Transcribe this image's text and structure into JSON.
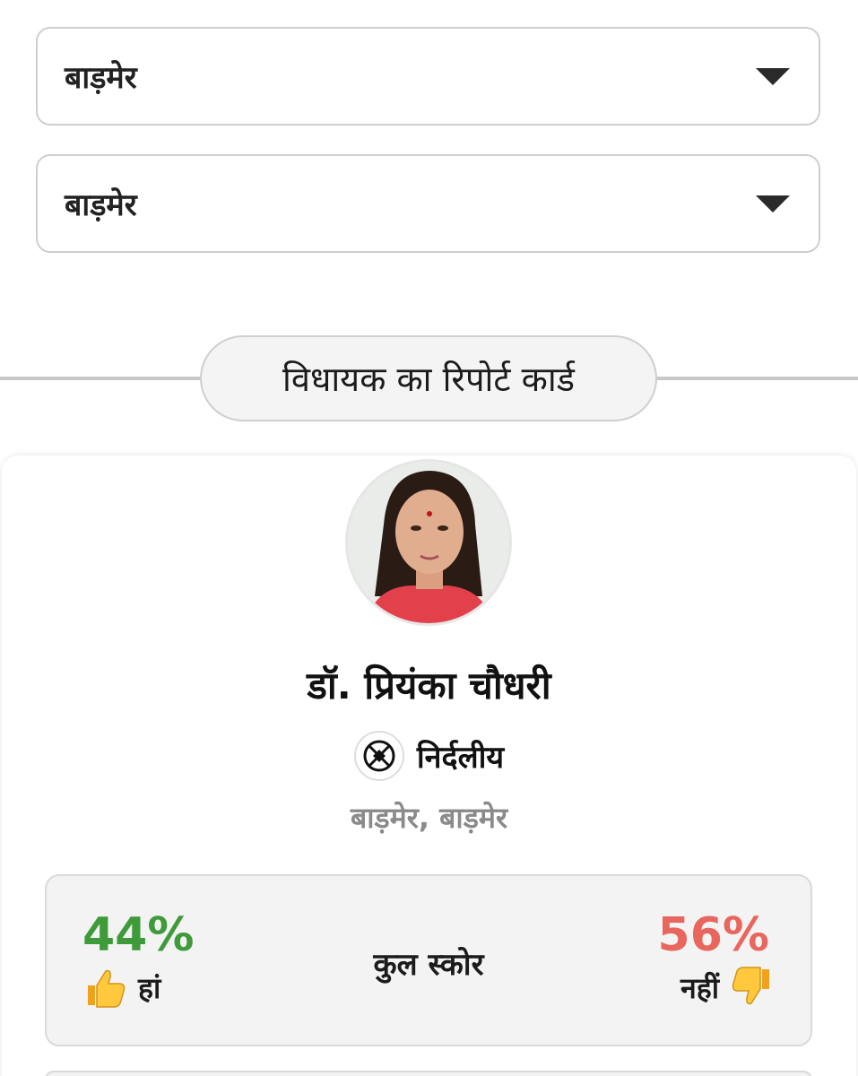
{
  "filters": {
    "district": {
      "selected": "बाड़मेर"
    },
    "constituency": {
      "selected": "बाड़मेर"
    }
  },
  "section": {
    "title": "विधायक का रिपोर्ट कार्ड"
  },
  "mla": {
    "name": "डॉ. प्रियंका चौधरी",
    "party": "निर्दलीय",
    "party_icon": "independent-symbol-icon",
    "location": "बाड़मेर, बाड़मेर"
  },
  "score": {
    "label": "कुल स्कोर",
    "yes_percent": "44%",
    "yes_label": "हां",
    "no_percent": "56%",
    "no_label": "नहीं",
    "yes_color": "#3f9a3a",
    "no_color": "#e8665e"
  }
}
